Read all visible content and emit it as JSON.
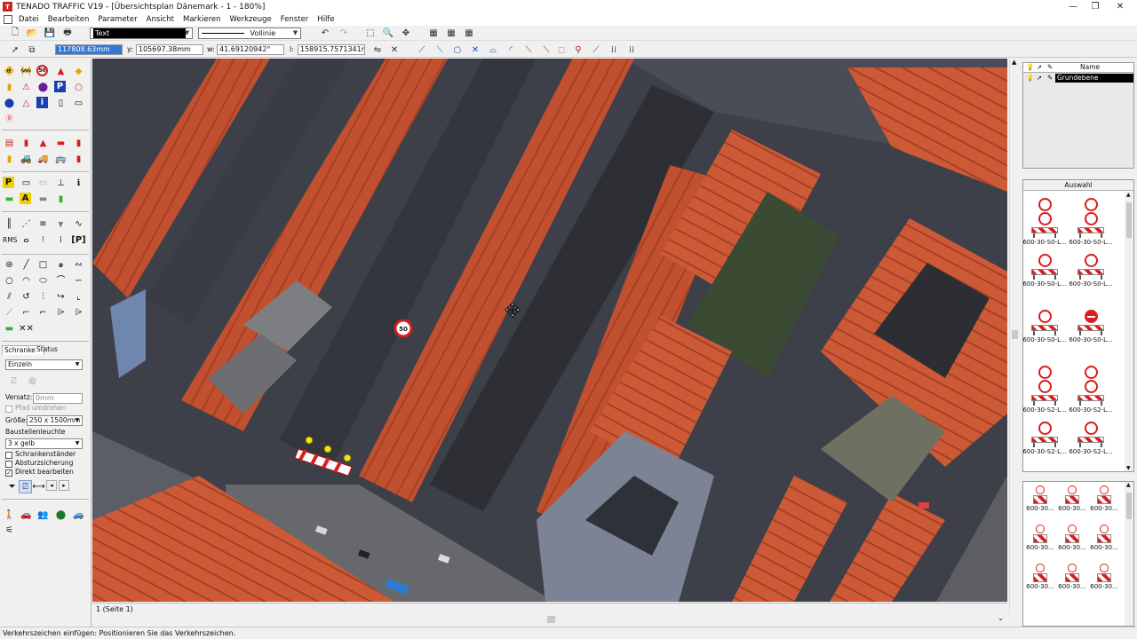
{
  "window": {
    "title": "TENADO TRAFFIC V19 - [Übersichtsplan Dänemark - 1 - 180%]"
  },
  "menu": [
    "Datei",
    "Bearbeiten",
    "Parameter",
    "Ansicht",
    "Markieren",
    "Werkzeuge",
    "Fenster",
    "Hilfe"
  ],
  "toolbar": {
    "text_combo": "Text",
    "line_combo": "Vollinie"
  },
  "coords": {
    "x_label": "x:",
    "x_value": "117808.63mm",
    "y_label": "y:",
    "y_value": "105697.38mm",
    "w_label": "w:",
    "w_value": "41.69120942°",
    "l_label": "l:",
    "l_value": "158915.7571341mm"
  },
  "left_panel": {
    "rms_label": "RMS",
    "tabs": [
      "Schranke",
      "Status"
    ],
    "mode": "Einzeln",
    "versatz_label": "Versatz:",
    "versatz_value": "0mm",
    "pfad_label": "Pfad umdrehen",
    "groesse_label": "Größe:",
    "groesse_value": "250 x 1500mm",
    "leuchte_label": "Baustellenleuchte",
    "leuchte_value": "3 x gelb",
    "checks": [
      {
        "label": "Schrankenständer",
        "checked": false
      },
      {
        "label": "Absturzsicherung",
        "checked": false
      },
      {
        "label": "Direkt bearbeiten",
        "checked": true
      }
    ]
  },
  "map": {
    "speed_sign": "50"
  },
  "page_tab": "1 (Seite 1)",
  "layers": {
    "header": "Name",
    "row": "Grundebene"
  },
  "selection": {
    "header": "Auswahl",
    "items": [
      {
        "caption": "600-30-S0-L..."
      },
      {
        "caption": "600-30-S0-L..."
      },
      {
        "caption": "600-30-S0-L..."
      },
      {
        "caption": "600-30-S0-L..."
      },
      {
        "caption": "600-30-S0-L..."
      },
      {
        "caption": "600-30-S0-L..."
      },
      {
        "caption": "600-30-S2-L..."
      },
      {
        "caption": "600-30-S2-L..."
      },
      {
        "caption": "600-30-S2-L..."
      },
      {
        "caption": "600-30-S2-L..."
      }
    ],
    "items2": [
      "600-30...",
      "600-30...",
      "600-30...",
      "600-30...",
      "600-30...",
      "600-30...",
      "600-30...",
      "600-30...",
      "600-30..."
    ]
  },
  "status": "Verkehrszeichen einfügen: Positionieren Sie das Verkehrszeichen."
}
